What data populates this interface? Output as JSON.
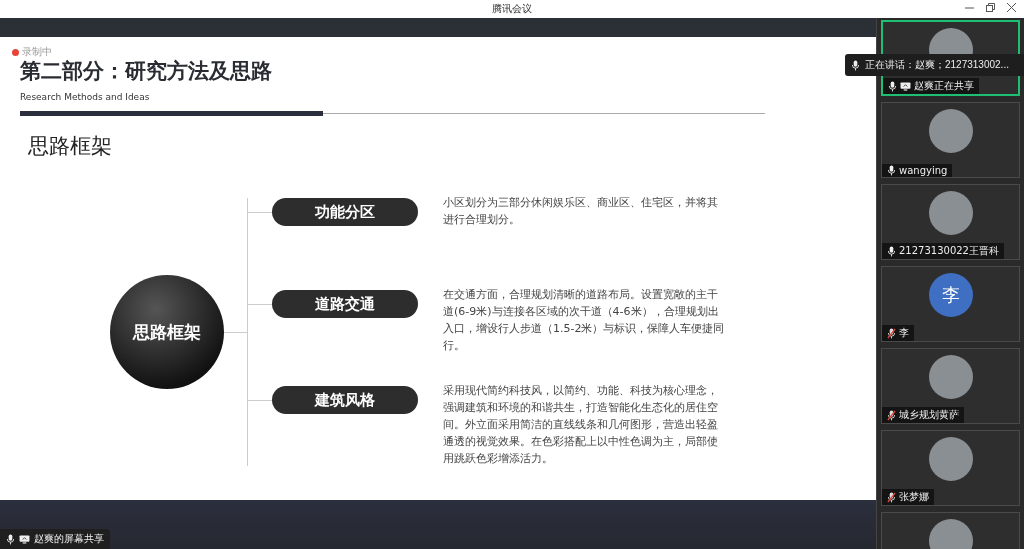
{
  "window": {
    "title": "腾讯会议"
  },
  "recording": {
    "label": "录制中"
  },
  "slide": {
    "title": "第二部分：研究方法及思路",
    "subtitle": "Research Methods and Ideas",
    "heading": "思路框架",
    "center": "思路框架",
    "branches": [
      {
        "label": "功能分区",
        "text": "小区划分为三部分休闲娱乐区、商业区、住宅区，并将其进行合理划分。"
      },
      {
        "label": "道路交通",
        "text": "在交通方面，合理规划清晰的道路布局。设置宽敞的主干道(6-9米)与连接各区域的次干道（4-6米），合理规划出入口，增设行人步道（1.5-2米）与标识，保障人车便捷同行。"
      },
      {
        "label": "建筑风格",
        "text": "采用现代简约科技风，以简约、功能、科技为核心理念，强调建筑和环境的和谐共生，打造智能化生态化的居住空间。外立面采用简洁的直线线条和几何图形，营造出轻盈通透的视觉效果。在色彩搭配上以中性色调为主，局部使用跳跃色彩增添活力。"
      }
    ]
  },
  "share_label": "赵爽的屏幕共享",
  "speaking": {
    "text": "正在讲话：赵爽；2127313002..."
  },
  "participants": [
    {
      "name": "赵爽正在共享",
      "muted": false,
      "sharing": true,
      "selected": true,
      "kind": "photo"
    },
    {
      "name": "wangying",
      "muted": false,
      "sharing": false,
      "selected": false,
      "kind": "photo"
    },
    {
      "name": "21273130022王晋科",
      "muted": false,
      "sharing": false,
      "selected": false,
      "kind": "photo"
    },
    {
      "name": "李",
      "muted": true,
      "sharing": false,
      "selected": false,
      "kind": "initial",
      "initial": "李"
    },
    {
      "name": "城乡规划黄萨",
      "muted": true,
      "sharing": false,
      "selected": false,
      "kind": "photo"
    },
    {
      "name": "张梦娜",
      "muted": true,
      "sharing": false,
      "selected": false,
      "kind": "photo"
    },
    {
      "selected": false,
      "kind": "photo"
    }
  ]
}
